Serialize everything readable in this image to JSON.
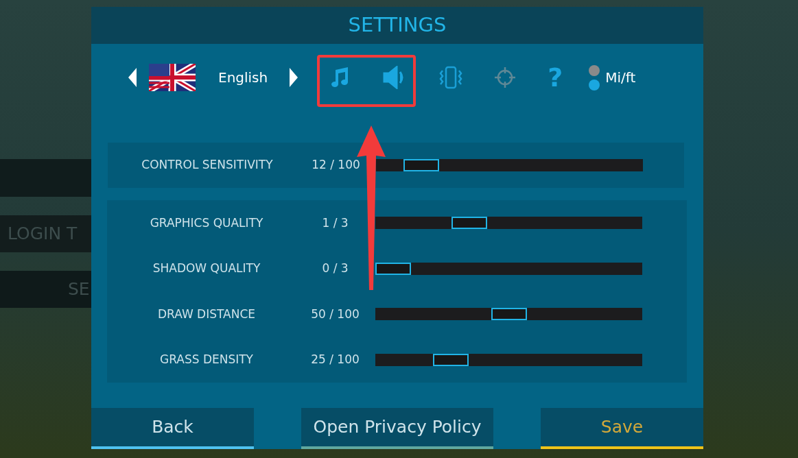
{
  "background_menu": [
    {
      "label": "LOGIN T"
    },
    {
      "label": "SE"
    }
  ],
  "window": {
    "title": "SETTINGS"
  },
  "language": {
    "label": "English"
  },
  "toggles": [
    {
      "kind": "music",
      "on": true
    },
    {
      "kind": "sound",
      "on": true
    },
    {
      "kind": "vibration",
      "on": true
    },
    {
      "kind": "crosshair",
      "on": false
    }
  ],
  "help_button": {
    "label": "?"
  },
  "units": {
    "label": "Mi/ft",
    "imperial": true
  },
  "control_panel": [
    {
      "name": "CONTROL SENSITIVITY",
      "reading": "12 / 100",
      "level": 0.12
    }
  ],
  "graphics_panel": [
    {
      "name": "GRAPHICS QUALITY",
      "reading": "1 / 3",
      "level": 0.33
    },
    {
      "name": "SHADOW QUALITY",
      "reading": "0 / 3",
      "level": 0
    },
    {
      "name": "DRAW DISTANCE",
      "reading": "50 / 100",
      "level": 0.5
    },
    {
      "name": "GRASS DENSITY",
      "reading": "25 / 100",
      "level": 0.25
    }
  ],
  "buttons": [
    {
      "label": "Back",
      "kind": "back"
    },
    {
      "label": "Open Privacy Policy",
      "kind": "privacy"
    },
    {
      "label": "Save",
      "kind": "save"
    }
  ]
}
